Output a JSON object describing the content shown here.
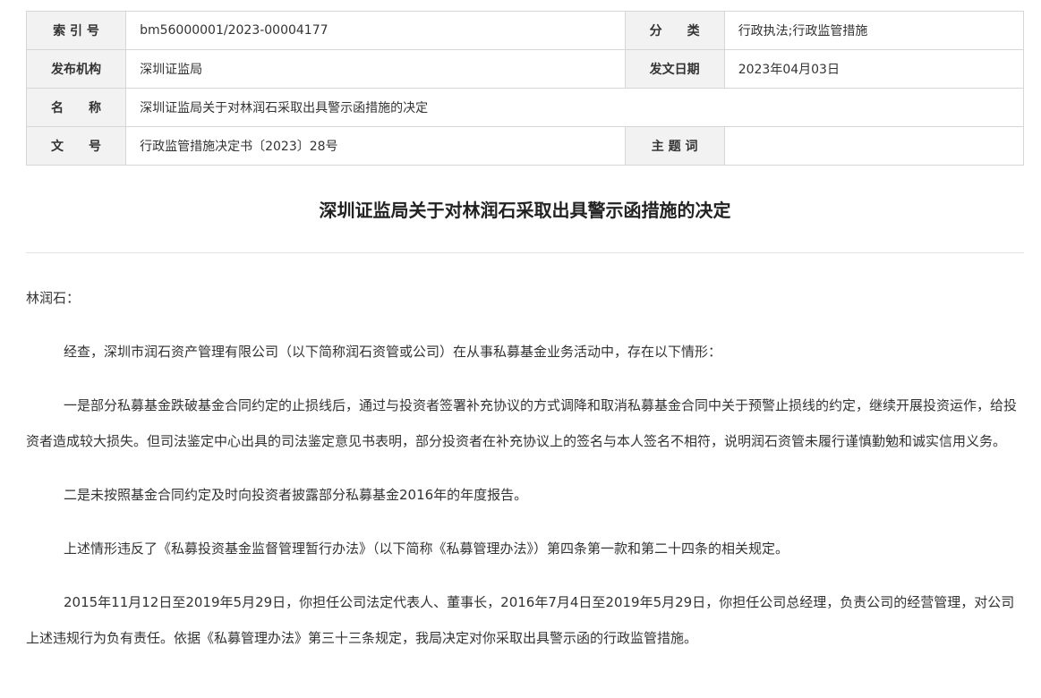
{
  "meta": {
    "index_label": "索 引 号",
    "index_value": "bm56000001/2023-00004177",
    "category_label": "分　　类",
    "category_value": "行政执法;行政监管措施",
    "publisher_label": "发布机构",
    "publisher_value": "深圳证监局",
    "date_label": "发文日期",
    "date_value": "2023年04月03日",
    "name_label": "名　　称",
    "name_value": "深圳证监局关于对林润石采取出具警示函措施的决定",
    "doc_no_label": "文　　号",
    "doc_no_value": "行政监管措施决定书〔2023〕28号",
    "subject_label": "主 题 词",
    "subject_value": ""
  },
  "document": {
    "title": "深圳证监局关于对林润石采取出具警示函措施的决定",
    "salutation": "林润石：",
    "paragraphs": [
      "经查，深圳市润石资产管理有限公司（以下简称润石资管或公司）在从事私募基金业务活动中，存在以下情形：",
      "一是部分私募基金跌破基金合同约定的止损线后，通过与投资者签署补充协议的方式调降和取消私募基金合同中关于预警止损线的约定，继续开展投资运作，给投资者造成较大损失。但司法鉴定中心出具的司法鉴定意见书表明，部分投资者在补充协议上的签名与本人签名不相符，说明润石资管未履行谨慎勤勉和诚实信用义务。",
      "二是未按照基金合同约定及时向投资者披露部分私募基金2016年的年度报告。",
      "上述情形违反了《私募投资基金监督管理暂行办法》（以下简称《私募管理办法》）第四条第一款和第二十四条的相关规定。",
      "2015年11月12日至2019年5月29日，你担任公司法定代表人、董事长，2016年7月4日至2019年5月29日，你担任公司总经理，负责公司的经营管理，对公司上述违规行为负有责任。依据《私募管理办法》第三十三条规定，我局决定对你采取出具警示函的行政监管措施。"
    ]
  }
}
